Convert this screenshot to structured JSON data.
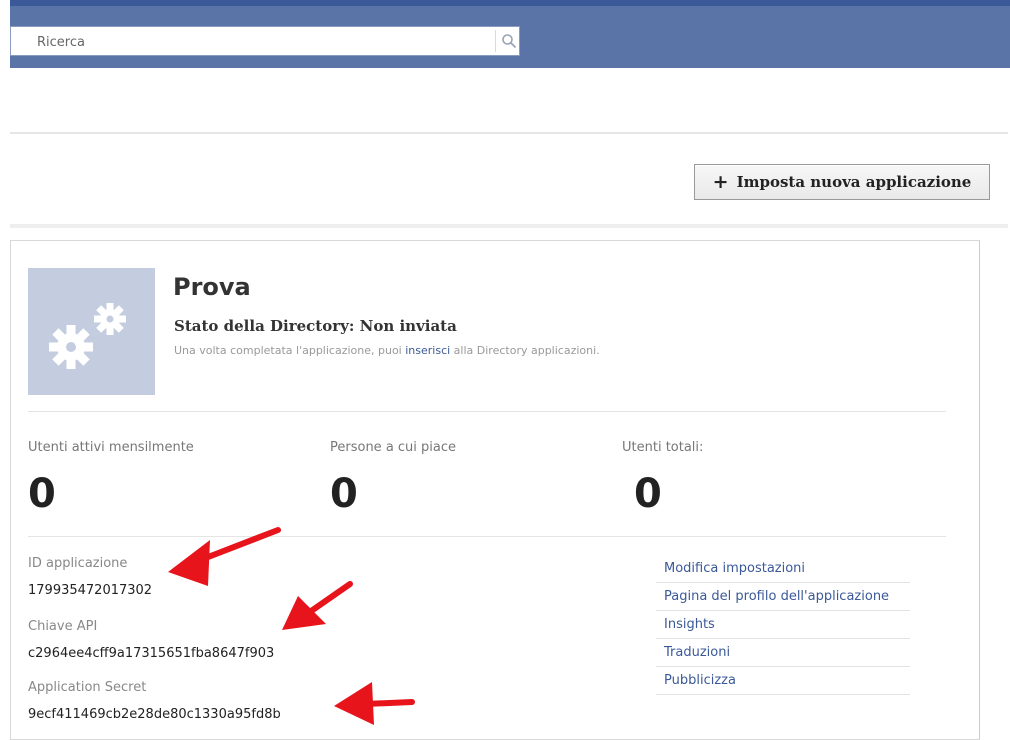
{
  "search": {
    "placeholder": "Ricerca"
  },
  "toolbar": {
    "new_app_label": "Imposta nuova applicazione",
    "new_app_plus": "+"
  },
  "app": {
    "name": "Prova",
    "directory_status": "Stato della Directory: Non inviata",
    "note_before": "Una volta completata l'applicazione, puoi ",
    "note_link": "inserisci",
    "note_after": " alla Directory applicazioni."
  },
  "stats": [
    {
      "label": "Utenti attivi mensilmente",
      "value": "0"
    },
    {
      "label": "Persone a cui piace",
      "value": "0"
    },
    {
      "label": "Utenti totali:",
      "value": "0"
    }
  ],
  "details": {
    "app_id_label": "ID applicazione",
    "app_id_value": "179935472017302",
    "api_key_label": "Chiave API",
    "api_key_value": "c2964ee4cff9a17315651fba8647f903",
    "secret_label": "Application Secret",
    "secret_value": "9ecf411469cb2e28de80c1330a95fd8b"
  },
  "sidebar": {
    "links": [
      "Modifica impostazioni",
      "Pagina del profilo dell'applicazione",
      "Insights",
      "Traduzioni",
      "Pubblicizza"
    ]
  },
  "colors": {
    "topbar": "#5b74a8",
    "link": "#3b5998",
    "arrow": "#e8141b",
    "app_icon_bg": "#c4cde0"
  }
}
